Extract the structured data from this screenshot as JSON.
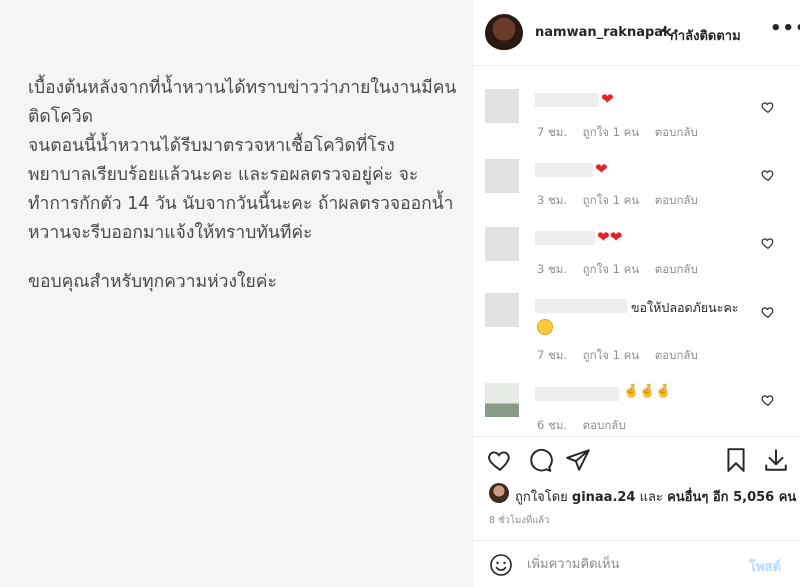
{
  "post": {
    "paragraph1": "เบื้องต้นหลังจากที่น้ำหวานได้ทราบข่าวว่าภายในงานมีคนติดโควิด\nจนตอนนี้น้ำหวานได้รีบมาตรวจหาเชื้อโควิดที่โรงพยาบาลเรียบร้อยแล้วนะคะ และรอผลตรวจอยู่ค่ะ จะทำการกักตัว 14 วัน นับจากวันนี้นะคะ ถ้าผลตรวจออกน้ำหวานจะรีบออกมาแจ้งให้ทราบทันทีค่ะ",
    "paragraph2": "ขอบคุณสำหรับทุกความห่วงใยค่ะ"
  },
  "header": {
    "username": "namwan_raknapak",
    "separator": "•",
    "follow_label": "กำลังติดตาม",
    "more_label": "•••"
  },
  "comments": [
    {
      "text": "",
      "emoji": "❤",
      "time": "7 ชม.",
      "likes": "ถูกใจ 1 คน",
      "reply": "ตอบกลับ"
    },
    {
      "text": "",
      "emoji": "❤",
      "time": "3 ชม.",
      "likes": "ถูกใจ 1 คน",
      "reply": "ตอบกลับ"
    },
    {
      "text": "",
      "emoji": "❤❤",
      "time": "3 ชม.",
      "likes": "ถูกใจ 1 คน",
      "reply": "ตอบกลับ"
    },
    {
      "text": "ขอให้ปลอดภัยนะคะ",
      "emoji": "",
      "time": "7 ชม.",
      "likes": "ถูกใจ 1 คน",
      "reply": "ตอบกลับ"
    },
    {
      "text": "",
      "emoji": "🤞🤞🤞",
      "time": "6 ชม.",
      "likes": "",
      "reply": "ตอบกลับ"
    }
  ],
  "likes": {
    "prefix": "ถูกใจโดย",
    "user": "ginaa.24",
    "middle": "และ",
    "others": "คนอื่นๆ อีก 5,056 คน"
  },
  "time_ago": "8 ชั่วโมงที่แล้ว",
  "add_comment": {
    "placeholder": "เพิ่มความคิดเห็น",
    "post_label": "โพสต์"
  },
  "colors": {
    "heart": "#e8202c",
    "post_button_disabled": "#b3dbff",
    "meta_gray": "#8e8e8e"
  }
}
